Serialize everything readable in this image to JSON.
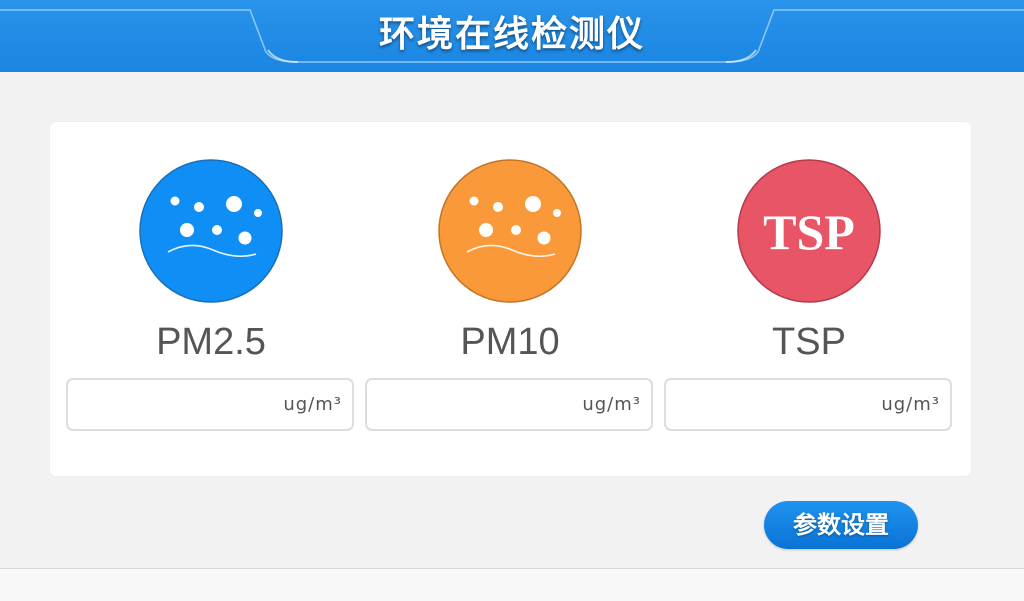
{
  "header": {
    "title": "环境在线检测仪"
  },
  "sensors": [
    {
      "name": "PM2.5",
      "unit": "ug/m³",
      "value": "",
      "icon": "dust-particles-icon",
      "color": "#0f8ff6"
    },
    {
      "name": "PM10",
      "unit": "ug/m³",
      "value": "",
      "icon": "dust-particles-icon",
      "color": "#f9993a"
    },
    {
      "name": "TSP",
      "unit": "ug/m³",
      "value": "",
      "icon": "tsp-icon",
      "icon_text": "TSP",
      "color": "#e85567"
    }
  ],
  "settings_button": {
    "label": "参数设置"
  },
  "colors": {
    "header": "#1a86e2",
    "background": "#f2f2f2",
    "card": "#ffffff",
    "button": "#0f83e8"
  }
}
